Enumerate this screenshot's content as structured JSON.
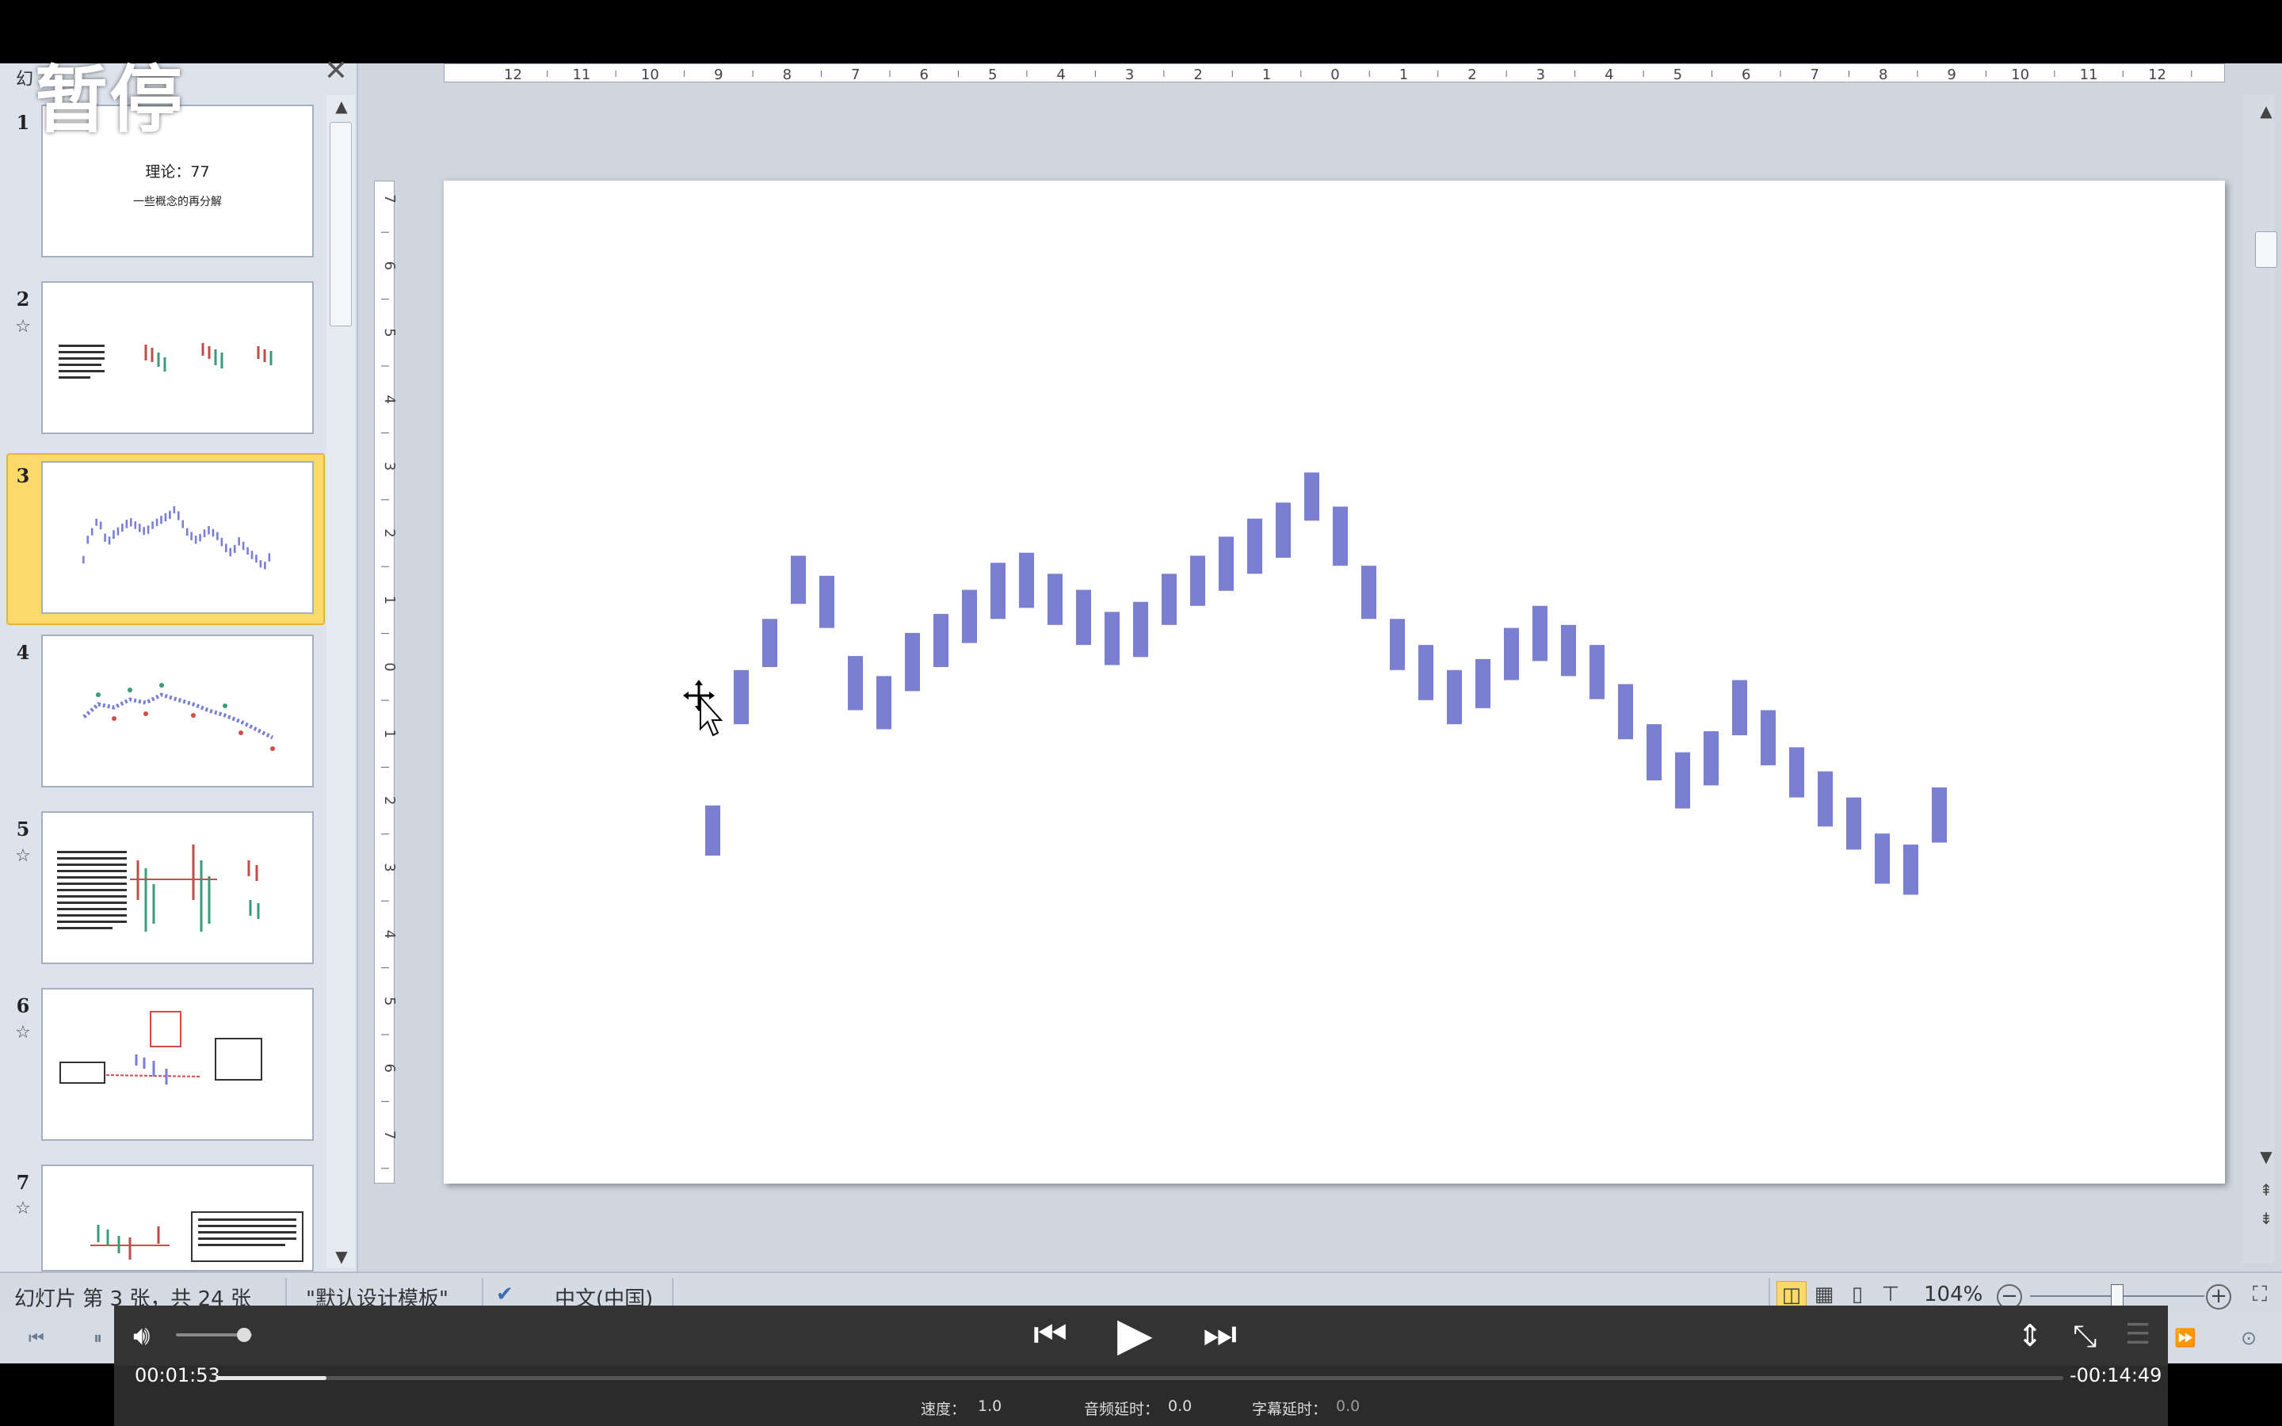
{
  "overlay": {
    "paused_label": "暂停"
  },
  "slide_panel": {
    "tab_label": "幻",
    "close_glyph": "✕",
    "slides": [
      {
        "number": "1",
        "has_animation": false,
        "title_text": "理论：77",
        "subtitle_text": "一些概念的再分解"
      },
      {
        "number": "2",
        "has_animation": true
      },
      {
        "number": "3",
        "has_animation": false,
        "selected": true
      },
      {
        "number": "4",
        "has_animation": false
      },
      {
        "number": "5",
        "has_animation": true
      },
      {
        "number": "6",
        "has_animation": true
      },
      {
        "number": "7",
        "has_animation": true
      }
    ],
    "animation_glyph": "☆"
  },
  "ruler": {
    "horizontal_labels": [
      "12",
      "11",
      "10",
      "9",
      "8",
      "7",
      "6",
      "5",
      "4",
      "3",
      "2",
      "1",
      "0",
      "1",
      "2",
      "3",
      "4",
      "5",
      "6",
      "7",
      "8",
      "9",
      "10",
      "11",
      "12"
    ],
    "vertical_labels": [
      "7",
      "6",
      "5",
      "4",
      "3",
      "2",
      "1",
      "0",
      "1",
      "2",
      "3",
      "4",
      "5",
      "6",
      "7"
    ]
  },
  "chart_data": {
    "type": "bar",
    "description_visible": "floating range bars (candles without wicks) on slide canvas",
    "color": "#7b7fd1",
    "bars": [
      {
        "low": 32.7,
        "high": 37.7
      },
      {
        "low": 45.8,
        "high": 51.2
      },
      {
        "low": 51.5,
        "high": 56.3
      },
      {
        "low": 57.8,
        "high": 62.6
      },
      {
        "low": 55.4,
        "high": 60.6
      },
      {
        "low": 47.2,
        "high": 52.6
      },
      {
        "low": 45.3,
        "high": 50.6
      },
      {
        "low": 49.1,
        "high": 54.9
      },
      {
        "low": 51.5,
        "high": 56.8
      },
      {
        "low": 53.9,
        "high": 59.2
      },
      {
        "low": 56.3,
        "high": 61.9
      },
      {
        "low": 57.4,
        "high": 62.9
      },
      {
        "low": 55.7,
        "high": 60.8
      },
      {
        "low": 53.7,
        "high": 59.2
      },
      {
        "low": 51.7,
        "high": 57.0
      },
      {
        "low": 52.5,
        "high": 58.0
      },
      {
        "low": 55.7,
        "high": 60.8
      },
      {
        "low": 57.6,
        "high": 62.6
      },
      {
        "low": 59.1,
        "high": 64.5
      },
      {
        "low": 60.8,
        "high": 66.3
      },
      {
        "low": 62.4,
        "high": 67.9
      },
      {
        "low": 66.1,
        "high": 70.9
      },
      {
        "low": 61.6,
        "high": 67.5
      },
      {
        "low": 56.3,
        "high": 61.6
      },
      {
        "low": 51.2,
        "high": 56.3
      },
      {
        "low": 48.2,
        "high": 53.7
      },
      {
        "low": 45.8,
        "high": 51.2
      },
      {
        "low": 47.4,
        "high": 52.3
      },
      {
        "low": 50.2,
        "high": 55.4
      },
      {
        "low": 52.1,
        "high": 57.6
      },
      {
        "low": 50.6,
        "high": 55.7
      },
      {
        "low": 48.3,
        "high": 53.7
      },
      {
        "low": 44.3,
        "high": 49.8
      },
      {
        "low": 40.2,
        "high": 45.8
      },
      {
        "low": 37.4,
        "high": 43.0
      },
      {
        "low": 39.7,
        "high": 45.1
      },
      {
        "low": 44.7,
        "high": 50.2
      },
      {
        "low": 41.7,
        "high": 47.2
      },
      {
        "low": 38.5,
        "high": 43.5
      },
      {
        "low": 35.6,
        "high": 41.1
      },
      {
        "low": 33.3,
        "high": 38.5
      },
      {
        "low": 29.9,
        "high": 34.9
      },
      {
        "low": 28.8,
        "high": 33.8
      },
      {
        "low": 34.0,
        "high": 39.5
      }
    ],
    "ylim": [
      0,
      100
    ]
  },
  "statusbar": {
    "slide_info": "幻灯片 第 3 张，共 24 张",
    "theme": "\"默认设计模板\"",
    "language": "中文(中国)",
    "zoom": "104%",
    "zoom_out": "−",
    "zoom_in": "+"
  },
  "player": {
    "elapsed": "00:01:53",
    "remaining": "-00:14:49",
    "progress": 0.06,
    "volume": 0.9,
    "speed_label": "速度：",
    "speed_value": "1.0",
    "audio_delay_label": "音频延时：",
    "audio_delay_value": "0.0",
    "subtitle_delay_label": "字幕延时：",
    "subtitle_delay_value": "0.0"
  }
}
